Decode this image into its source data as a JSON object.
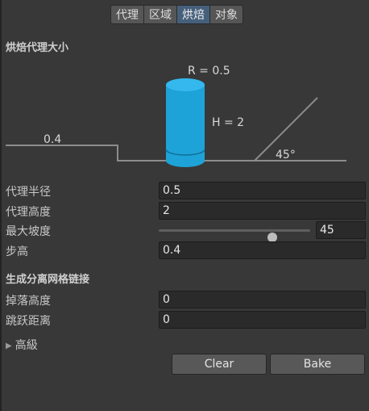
{
  "tabs": [
    {
      "label": "代理",
      "active": false
    },
    {
      "label": "区域",
      "active": false
    },
    {
      "label": "烘焙",
      "active": true
    },
    {
      "label": "对象",
      "active": false
    }
  ],
  "bake_agent_section": {
    "title": "烘焙代理大小",
    "diagram": {
      "radius_label": "R = 0.5",
      "height_label": "H = 2",
      "step_label": "0.4",
      "angle_label": "45°",
      "cylinder_color": "#1ea3d8"
    },
    "fields": {
      "agent_radius": {
        "label": "代理半径",
        "value": "0.5"
      },
      "agent_height": {
        "label": "代理高度",
        "value": "2"
      },
      "max_slope": {
        "label": "最大坡度",
        "value": "45",
        "slider_fraction": 0.75
      },
      "step_height": {
        "label": "步高",
        "value": "0.4"
      }
    }
  },
  "offmesh_section": {
    "title": "生成分离网格链接",
    "fields": {
      "drop_height": {
        "label": "掉落高度",
        "value": "0"
      },
      "jump_distance": {
        "label": "跳跃距离",
        "value": "0"
      }
    }
  },
  "advanced": {
    "label": "高級",
    "expanded": false
  },
  "buttons": {
    "clear": "Clear",
    "bake": "Bake"
  },
  "colors": {
    "active_tab": "#46607c",
    "background": "#383838",
    "field_bg": "#2a2a2a"
  }
}
